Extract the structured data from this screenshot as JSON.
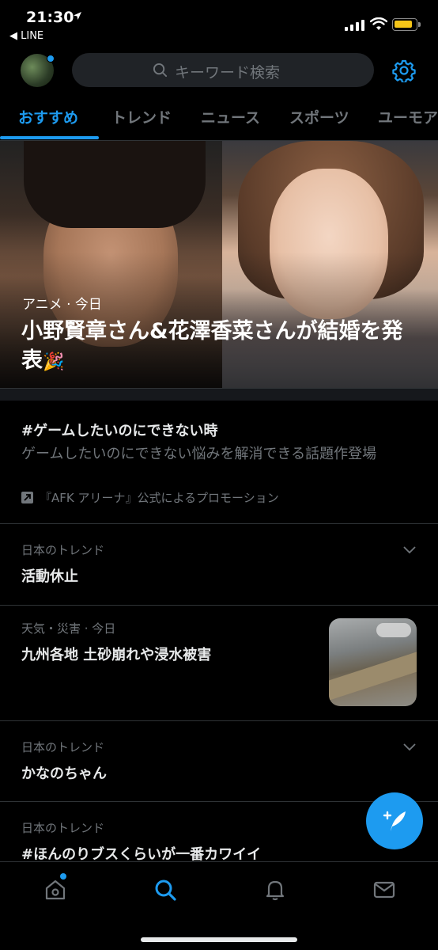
{
  "status_bar": {
    "time": "21:30",
    "back_app": "◀ LINE"
  },
  "header": {
    "search_placeholder": "キーワード検索"
  },
  "tabs": [
    {
      "label": "おすすめ",
      "active": true
    },
    {
      "label": "トレンド"
    },
    {
      "label": "ニュース"
    },
    {
      "label": "スポーツ"
    },
    {
      "label": "ユーモア"
    }
  ],
  "hero": {
    "meta": "アニメ · 今日",
    "title": "小野賢章さん&花澤香菜さんが結婚を発表",
    "emoji": "🎉"
  },
  "trends": [
    {
      "type": "promoted",
      "title": "#ゲームしたいのにできない時",
      "description": "ゲームしたいのにできない悩みを解消できる話題作登場",
      "promo": "『AFK アリーナ』公式によるプロモーション"
    },
    {
      "type": "trend",
      "meta": "日本のトレンド",
      "title": "活動休止"
    },
    {
      "type": "news",
      "meta": "天気・災害 · 今日",
      "title": "九州各地 土砂崩れや浸水被害"
    },
    {
      "type": "trend",
      "meta": "日本のトレンド",
      "title": "かなのちゃん"
    },
    {
      "type": "trend",
      "meta": "日本のトレンド",
      "title": "#ほんのりブスくらいが一番カワイイ"
    }
  ],
  "colors": {
    "accent": "#1d9bf0",
    "background": "#000000",
    "muted": "#71767b",
    "divider": "#2f3336"
  },
  "icons": [
    "location-arrow-icon",
    "signal-icon",
    "wifi-icon",
    "battery-icon",
    "search-icon",
    "gear-icon",
    "promoted-icon",
    "chevron-down-icon",
    "compose-tweet-icon",
    "home-icon",
    "explore-icon",
    "bell-icon",
    "mail-icon"
  ]
}
